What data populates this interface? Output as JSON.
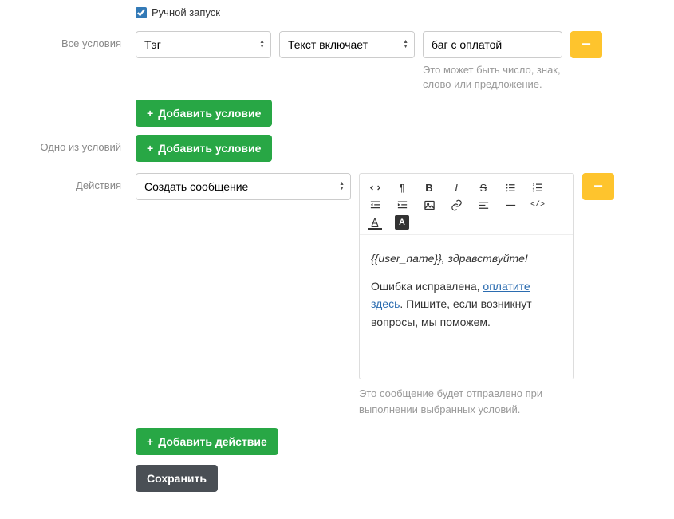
{
  "manual_launch": {
    "label": "Ручной запуск",
    "checked": true
  },
  "all_conditions": {
    "label": "Все условия",
    "field_select": "Тэг",
    "operator_select": "Текст включает",
    "value": "баг с оплатой",
    "value_hint": "Это может быть число, знак, слово или предложение.",
    "add_button": "Добавить условие"
  },
  "any_conditions": {
    "label": "Одно из условий",
    "add_button": "Добавить условие"
  },
  "actions": {
    "label": "Действия",
    "action_select": "Создать сообщение",
    "editor": {
      "greeting": "{{user_name}}, здравствуйте!",
      "body_prefix": "Ошибка исправлена, ",
      "body_link": "оплатите здесь",
      "body_suffix": ". Пишите, если возникнут вопросы, мы поможем."
    },
    "editor_hint": "Это сообщение будет отправлено при выполнении выбранных условий.",
    "add_button": "Добавить действие"
  },
  "save_button": "Сохранить",
  "remove_button": "−"
}
